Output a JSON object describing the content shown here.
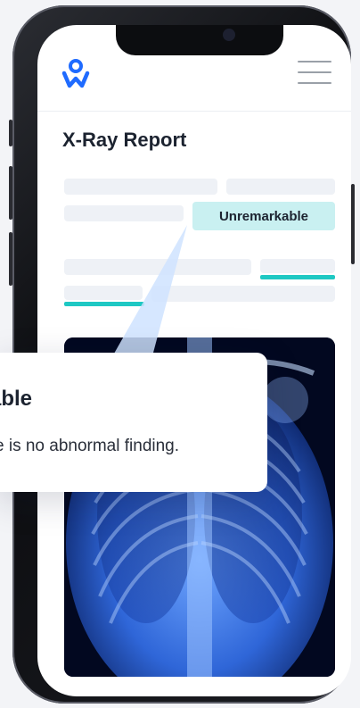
{
  "report": {
    "title": "X-Ray Report",
    "finding_chip": "Unremarkable",
    "callout_title": "able",
    "callout_text": "e is no abnormal finding."
  },
  "colors": {
    "accent": "#1ec8c3",
    "chip_bg": "#c9f0f1",
    "logo_blue": "#1f6bff"
  },
  "icons": {
    "logo": "person-logo-icon",
    "menu": "hamburger-menu-icon"
  }
}
